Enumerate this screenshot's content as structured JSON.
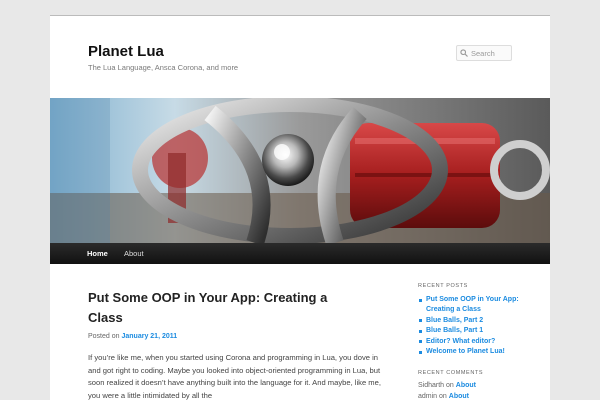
{
  "site": {
    "title": "Planet Lua",
    "description": "The Lua Language, Ansca Corona, and more"
  },
  "search": {
    "placeholder": "Search",
    "icon": "search-icon"
  },
  "banner": {
    "icon": "mechanical-wheel-photo"
  },
  "nav": {
    "items": [
      {
        "label": "Home"
      },
      {
        "label": "About"
      }
    ]
  },
  "post": {
    "title": "Put Some OOP in Your App: Creating a Class",
    "posted_on_label": "Posted on",
    "date": "January 21, 2011",
    "excerpt": "If you’re like me, when you started using Corona and programming in Lua, you dove in and got right to coding. Maybe you looked into object-oriented programming in Lua, but soon realized it doesn’t have anything built into the language for it. And maybe, like me, you were a little intimidated by all the"
  },
  "sidebar": {
    "recent_posts_title": "RECENT POSTS",
    "recent_posts": [
      {
        "label": "Put Some OOP in Your App: Creating a Class"
      },
      {
        "label": "Blue Balls, Part 2"
      },
      {
        "label": "Blue Balls, Part 1"
      },
      {
        "label": "Editor? What editor?"
      },
      {
        "label": "Welcome to Planet Lua!"
      }
    ],
    "recent_comments_title": "RECENT COMMENTS",
    "recent_comments": [
      {
        "author": "Sidharth",
        "on": "on",
        "post": "About"
      },
      {
        "author": "admin",
        "on": "on",
        "post": "About"
      }
    ]
  },
  "colors": {
    "link": "#1b8be0",
    "nav_background": "#1a1a1a",
    "page_background": "#e8e8e8"
  }
}
